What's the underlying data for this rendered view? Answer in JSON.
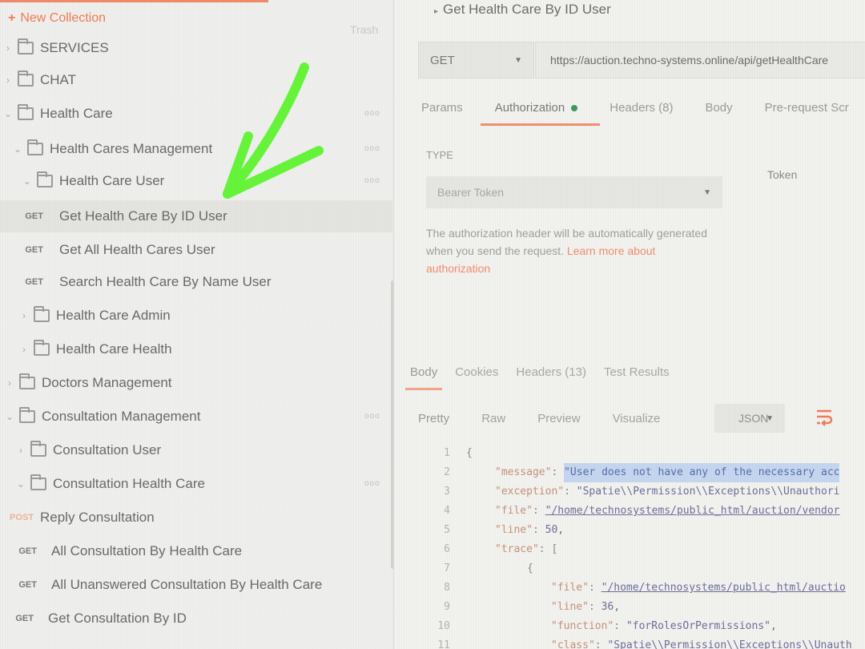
{
  "sidebar": {
    "new_collection_label": "New Collection",
    "trash_label": "Trash",
    "items": [
      {
        "kind": "folder",
        "label": "SERVICES",
        "expanded": false,
        "level": 0
      },
      {
        "kind": "folder",
        "label": "CHAT",
        "expanded": false,
        "level": 0
      },
      {
        "kind": "folder",
        "label": "Health Care",
        "expanded": true,
        "level": 0
      },
      {
        "kind": "folder",
        "label": "Health Cares Management",
        "expanded": true,
        "level": 1
      },
      {
        "kind": "folder",
        "label": "Health Care User",
        "expanded": true,
        "level": 2
      },
      {
        "kind": "request",
        "method": "GET",
        "label": "Get Health Care By ID User"
      },
      {
        "kind": "request",
        "method": "GET",
        "label": "Get All Health Cares User"
      },
      {
        "kind": "request",
        "method": "GET",
        "label": "Search Health Care By Name User"
      },
      {
        "kind": "folder",
        "label": "Health Care Admin",
        "expanded": false,
        "level": 2
      },
      {
        "kind": "folder",
        "label": "Health Care Health",
        "expanded": false,
        "level": 2
      },
      {
        "kind": "folder",
        "label": "Doctors Management",
        "expanded": false,
        "level": 1
      },
      {
        "kind": "folder",
        "label": "Consultation Management",
        "expanded": true,
        "level": 1
      },
      {
        "kind": "folder",
        "label": "Consultation User",
        "expanded": false,
        "level": 2
      },
      {
        "kind": "folder",
        "label": "Consultation Health Care",
        "expanded": true,
        "level": 2
      },
      {
        "kind": "request",
        "method": "POST",
        "label": "Reply Consultation"
      },
      {
        "kind": "request",
        "method": "GET",
        "label": "All Consultation By Health Care"
      },
      {
        "kind": "request",
        "method": "GET",
        "label": "All Unanswered Consultation By Health Care"
      },
      {
        "kind": "request",
        "method": "GET",
        "label": "Get Consultation By ID"
      }
    ]
  },
  "request": {
    "title": "Get Health Care By ID User",
    "method": "GET",
    "url": "https://auction.techno-systems.online/api/getHealthCare",
    "tabs": [
      "Params",
      "Authorization",
      "Headers (8)",
      "Body",
      "Pre-request Scr"
    ],
    "active_tab": "Authorization"
  },
  "auth": {
    "type_label": "TYPE",
    "type_value": "Bearer Token",
    "token_label": "Token",
    "help_text": "The authorization header will be automatically generated when you send the request.",
    "help_link": "Learn more about authorization"
  },
  "response": {
    "tabs": [
      "Body",
      "Cookies",
      "Headers (13)",
      "Test Results"
    ],
    "active_tab": "Body",
    "formats": [
      "Pretty",
      "Raw",
      "Preview",
      "Visualize"
    ],
    "active_format": "Pretty",
    "language": "JSON",
    "lines": {
      "n1": "1",
      "n2": "2",
      "n3": "3",
      "n4": "4",
      "n5": "5",
      "n6": "6",
      "n7": "7",
      "n8": "8",
      "n9": "9",
      "n10": "10",
      "n11": "11",
      "open_brace": "{",
      "message_key": "\"message\"",
      "message_val": "\"User does not have any of the necessary acc",
      "exception_key": "\"exception\"",
      "exception_val": "\"Spatie\\\\Permission\\\\Exceptions\\\\Unauthori",
      "file_key": "\"file\"",
      "file_val": "\"/home/technosystems/public_html/auction/vendor",
      "line_key": "\"line\"",
      "line_val": "50,",
      "trace_key": "\"trace\"",
      "trace_open": "[",
      "obj_open": "{",
      "file2_key": "\"file\"",
      "file2_val": "\"/home/technosystems/public_html/auctio",
      "line2_key": "\"line\"",
      "line2_val": "36,",
      "function_key": "\"function\"",
      "function_val": "\"forRolesOrPermissions\",",
      "class_key": "\"class\"",
      "class_val": "\"Spatie\\\\Permission\\\\Exceptions\\\\Unauth"
    }
  },
  "colors": {
    "accent": "#f47a52",
    "arrow": "#66f53a",
    "auth_dot": "#3c9a5c",
    "highlight": "#c6d6f0"
  }
}
